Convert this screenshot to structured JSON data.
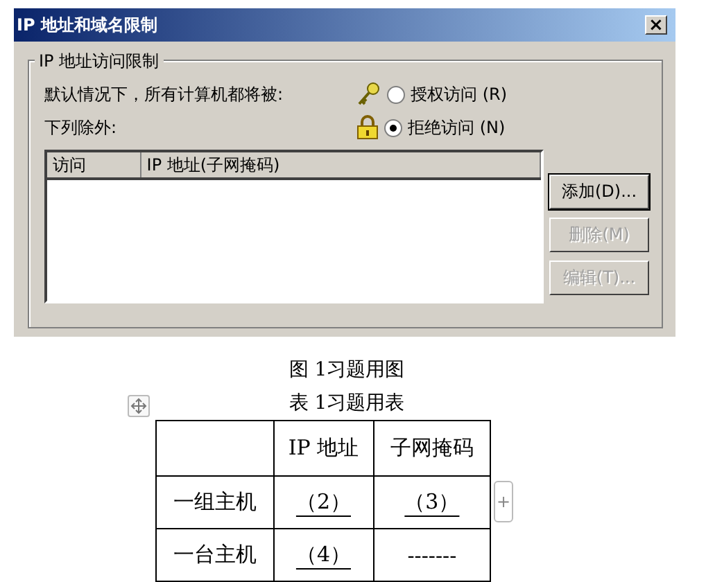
{
  "dialog": {
    "title": "IP 地址和域名限制",
    "close": "×",
    "group_title": "IP 地址访问限制",
    "default_label": "默认情况下，所有计算机都将被:",
    "except_label": "下列除外:",
    "options": [
      {
        "kind": "grant",
        "label": "授权访问 (R)",
        "selected": false
      },
      {
        "kind": "deny",
        "label": "拒绝访问 (N)",
        "selected": true
      }
    ],
    "list_columns": [
      "访问",
      "IP 地址(子网掩码)"
    ],
    "buttons": [
      {
        "label": "添加(D)...",
        "disabled": false,
        "default": true
      },
      {
        "label": "删除(M)",
        "disabled": true,
        "default": false
      },
      {
        "label": "编辑(T)...",
        "disabled": true,
        "default": false
      }
    ]
  },
  "figure_caption": "图 1习题用图",
  "table_caption": "表 1习题用表",
  "table": {
    "columns": [
      "",
      "IP 地址",
      "子网掩码"
    ],
    "rows": [
      [
        "一组主机",
        "（2）",
        "（3）"
      ],
      [
        "一台主机",
        "（4）",
        "-------"
      ]
    ]
  },
  "add_row_button": "+"
}
